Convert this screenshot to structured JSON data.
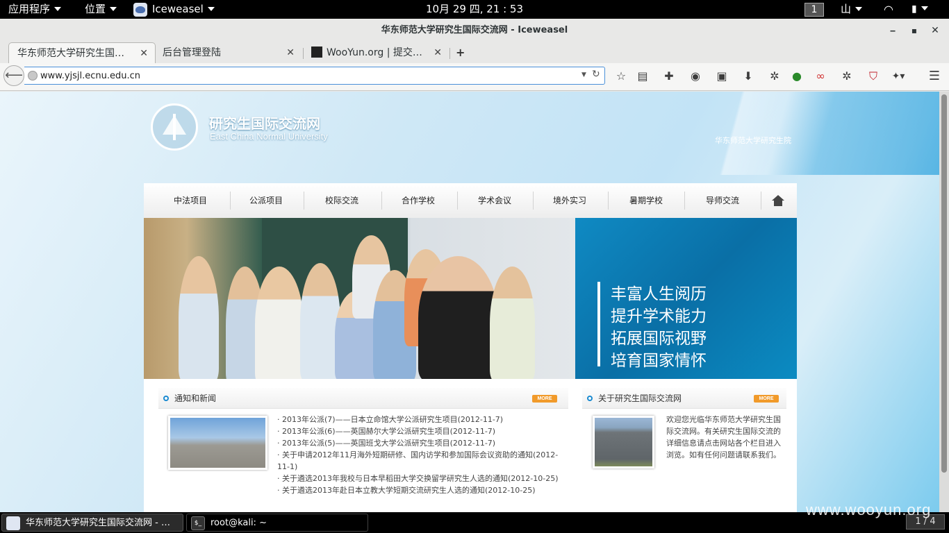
{
  "topbar": {
    "apps_menu": "应用程序",
    "places_menu": "位置",
    "active_app": "Iceweasel",
    "clock": "10月 29 四, 21 : 53",
    "workspace": "1",
    "input_method": "山"
  },
  "window": {
    "title": "华东师范大学研究生国际交流网 - Iceweasel"
  },
  "tabs": [
    {
      "label": "华东师范大学研究生国…",
      "active": true
    },
    {
      "label": "后台管理登陆",
      "active": false
    },
    {
      "label": "WooYun.org | 提交…",
      "active": false
    }
  ],
  "navbar": {
    "url": "www.yjsjl.ecnu.edu.cn"
  },
  "site": {
    "title_cn": "研究生国际交流网",
    "title_en": "East China Normal University",
    "college": "华东师范大学研究生院",
    "nav": [
      "中法项目",
      "公派项目",
      "校际交流",
      "合作学校",
      "学术会议",
      "境外实习",
      "暑期学校",
      "导师交流"
    ],
    "slogans": [
      "丰富人生阅历",
      "提升学术能力",
      "拓展国际视野",
      "培育国家情怀"
    ],
    "news": {
      "title": "通知和新闻",
      "more": "MORE",
      "items": [
        "· 2013年公派(7)——日本立命馆大学公派研究生项目(2012-11-7)",
        "· 2013年公派(6)——英国赫尔大学公派研究生项目(2012-11-7)",
        "· 2013年公派(5)——英国班戈大学公派研究生项目(2012-11-7)",
        "· 关于申请2012年11月海外短期研修、国内访学和参加国际会议资助的通知(2012-11-1)",
        "· 关于遴选2013年我校与日本早稻田大学交换留学研究生人选的通知(2012-10-25)",
        "· 关于遴选2013年赴日本立教大学短期交流研究生人选的通知(2012-10-25)"
      ]
    },
    "about": {
      "title": "关于研究生国际交流网",
      "more": "MORE",
      "text": "欢迎您光临华东师范大学研究生国际交流网。有关研究生国际交流的详细信息请点击网站各个栏目进入浏览。如有任何问题请联系我们。"
    }
  },
  "taskbar": {
    "tasks": [
      "华东师范大学研究生国际交流网 - …",
      "root@kali: ~"
    ],
    "pager": "1 / 4"
  },
  "watermark": "www.wooyun.org",
  "colors": {
    "accent_blue": "#0f8ac3",
    "more_badge": "#f19a2a",
    "url_focus": "#4a90d9"
  }
}
